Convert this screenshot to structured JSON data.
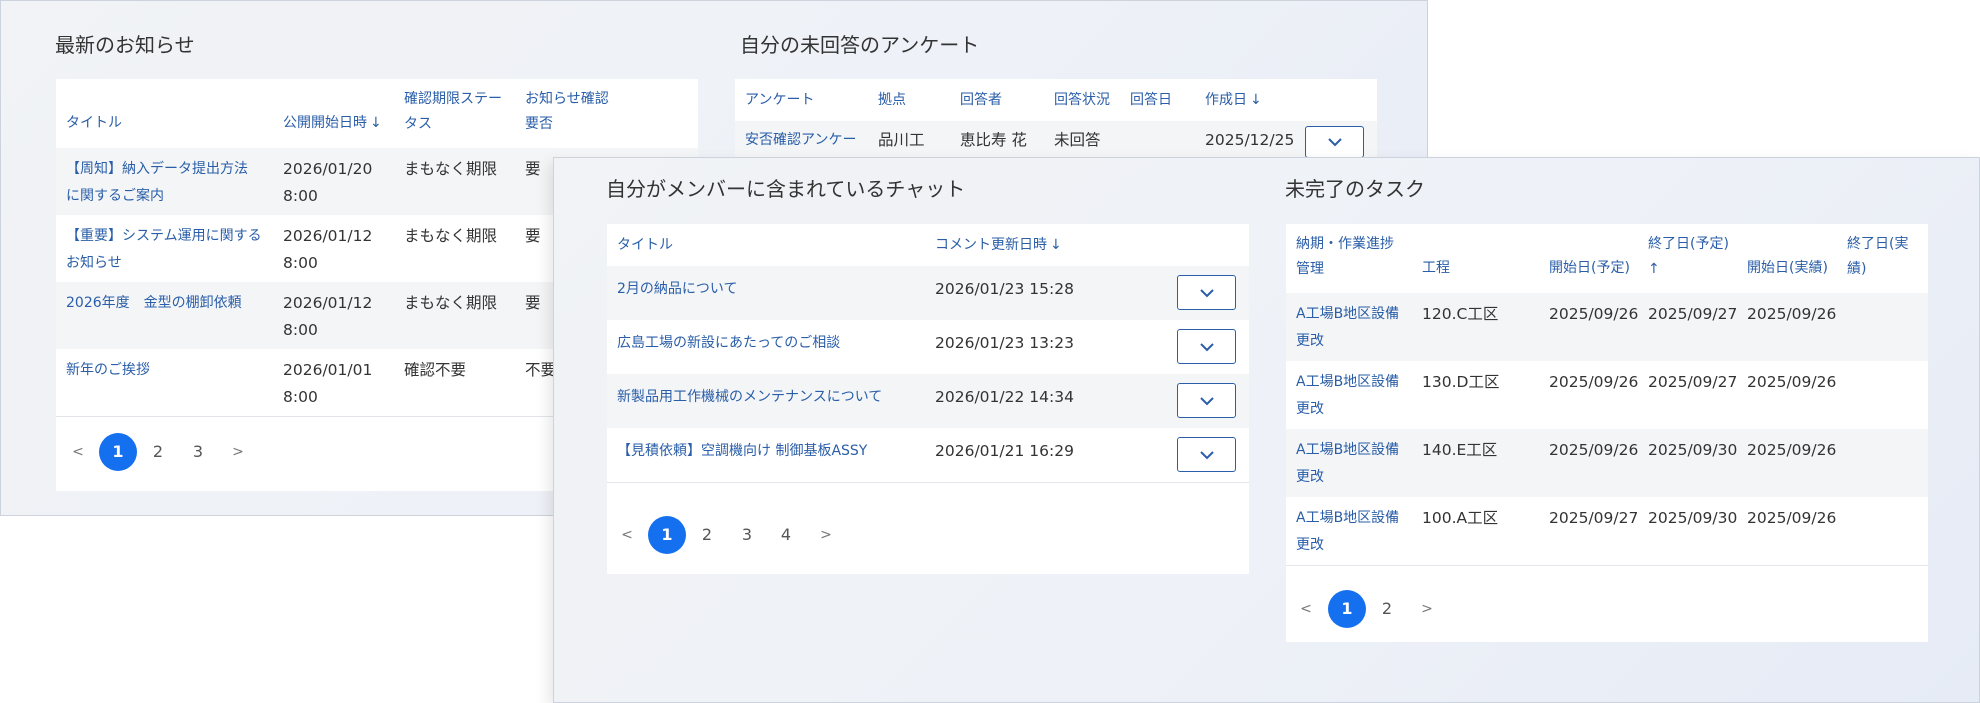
{
  "news": {
    "title": "最新のお知らせ",
    "columns": [
      "タイトル",
      "公開開始日時",
      "確認期限ステータス",
      "お知らせ確認要否"
    ],
    "col_title": "タイトル",
    "col_date": "公開開始日時",
    "col_deadline_1": "確認期限ステー",
    "col_deadline_2": "タス",
    "col_required_1": "お知らせ確認",
    "col_required_2": "要否",
    "rows": [
      {
        "title_1": "【周知】納入データ提出方法",
        "title_2": "に関するご案内",
        "date": "2026/01/20",
        "time": "8:00",
        "deadline": "まもなく期限",
        "required": "要"
      },
      {
        "title_1": "【重要】システム運用に関する",
        "title_2": "お知らせ",
        "date": "2026/01/12",
        "time": "8:00",
        "deadline": "まもなく期限",
        "required": "要"
      },
      {
        "title_1": "2026年度　金型の棚卸依頼",
        "title_2": "",
        "date": "2026/01/12",
        "time": "8:00",
        "deadline": "まもなく期限",
        "required": "要"
      },
      {
        "title_1": "新年のご挨拶",
        "title_2": "",
        "date": "2026/01/01",
        "time": "8:00",
        "deadline": "確認不要",
        "required": "不要"
      }
    ],
    "pager": {
      "prev": "<",
      "next": ">",
      "pages": [
        "1",
        "2",
        "3"
      ],
      "current": "1"
    }
  },
  "survey": {
    "title": "自分の未回答のアンケート",
    "col_survey": "アンケート",
    "col_site": "拠点",
    "col_respondent": "回答者",
    "col_status": "回答状況",
    "col_answer_date": "回答日",
    "col_created": "作成日",
    "rows": [
      {
        "survey": "安否確認アンケー",
        "site": "品川工",
        "respondent": "恵比寿 花",
        "status": "未回答",
        "answer_date": "",
        "created": "2025/12/25"
      }
    ]
  },
  "chat": {
    "title": "自分がメンバーに含まれているチャット",
    "col_title": "タイトル",
    "col_updated": "コメント更新日時",
    "rows": [
      {
        "title": "2月の納品について",
        "updated": "2026/01/23 15:28"
      },
      {
        "title": "広島工場の新設にあたってのご相談",
        "updated": "2026/01/23 13:23"
      },
      {
        "title": "新製品用工作機械のメンテナンスについて",
        "updated": "2026/01/22 14:34"
      },
      {
        "title": "【見積依頼】空調機向け 制御基板ASSY",
        "updated": "2026/01/21 16:29"
      }
    ],
    "pager": {
      "prev": "<",
      "next": ">",
      "pages": [
        "1",
        "2",
        "3",
        "4"
      ],
      "current": "1"
    }
  },
  "tasks": {
    "title": "未完了のタスク",
    "col_progress_1": "納期・作業進捗",
    "col_progress_2": "管理",
    "col_process": "工程",
    "col_start_plan": "開始日(予定)",
    "col_end_plan_1": "終了日(予定)",
    "col_end_plan_2": "↑",
    "col_start_actual": "開始日(実績)",
    "col_end_actual_1": "終了日(実",
    "col_end_actual_2": "績)",
    "rows": [
      {
        "name_1": "A工場B地区設備",
        "name_2": "更改",
        "process": "120.C工区",
        "start_plan": "2025/09/26",
        "end_plan": "2025/09/27",
        "start_actual": "2025/09/26",
        "end_actual": ""
      },
      {
        "name_1": "A工場B地区設備",
        "name_2": "更改",
        "process": "130.D工区",
        "start_plan": "2025/09/26",
        "end_plan": "2025/09/27",
        "start_actual": "2025/09/26",
        "end_actual": ""
      },
      {
        "name_1": "A工場B地区設備",
        "name_2": "更改",
        "process": "140.E工区",
        "start_plan": "2025/09/26",
        "end_plan": "2025/09/30",
        "start_actual": "2025/09/26",
        "end_actual": ""
      },
      {
        "name_1": "A工場B地区設備",
        "name_2": "更改",
        "process": "100.A工区",
        "start_plan": "2025/09/27",
        "end_plan": "2025/09/30",
        "start_actual": "2025/09/26",
        "end_actual": ""
      }
    ],
    "pager": {
      "prev": "<",
      "next": ">",
      "pages": [
        "1",
        "2"
      ],
      "current": "1"
    }
  },
  "icons": {
    "sort_down": "arrow-down-icon",
    "expand": "chevron-down-icon"
  },
  "colors": {
    "link": "#2a5ea8",
    "active_page": "#1570ef",
    "row_alt": "#f4f5f7"
  }
}
